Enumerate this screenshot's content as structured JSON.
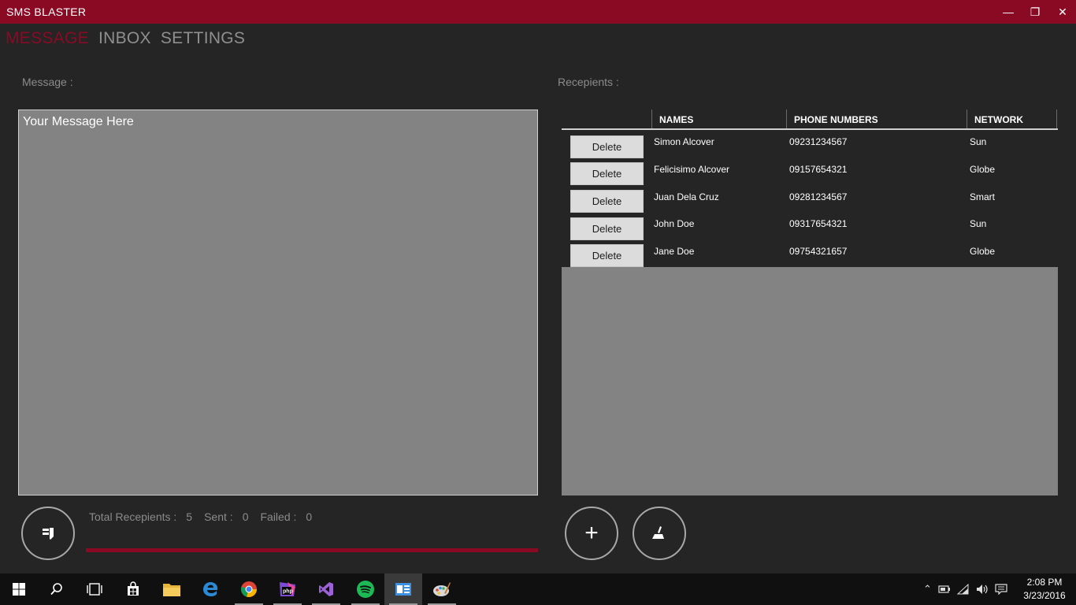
{
  "window": {
    "title": "SMS BLASTER",
    "minimize_glyph": "—",
    "maximize_glyph": "❐",
    "close_glyph": "✕",
    "accent_color": "#8a0a24"
  },
  "nav": {
    "tabs": [
      {
        "label": "MESSAGE",
        "active": true
      },
      {
        "label": "INBOX",
        "active": false
      },
      {
        "label": "SETTINGS",
        "active": false
      }
    ]
  },
  "message": {
    "label": "Message :",
    "placeholder": "Your Message Here"
  },
  "recipients": {
    "label": "Recepients :",
    "columns": [
      "NAMES",
      "PHONE NUMBERS",
      "NETWORK"
    ],
    "delete_label": "Delete",
    "rows": [
      {
        "name": "Simon Alcover",
        "phone": "09231234567",
        "network": "Sun"
      },
      {
        "name": "Felicisimo Alcover",
        "phone": "09157654321",
        "network": "Globe"
      },
      {
        "name": "Juan Dela Cruz",
        "phone": "09281234567",
        "network": "Smart"
      },
      {
        "name": "John Doe",
        "phone": "09317654321",
        "network": "Sun"
      },
      {
        "name": "Jane Doe",
        "phone": "09754321657",
        "network": "Globe"
      }
    ]
  },
  "stats": {
    "total_label": "Total Recepients :",
    "total_value": "5",
    "sent_label": "Sent :",
    "sent_value": "0",
    "failed_label": "Failed :",
    "failed_value": "0"
  },
  "actions": {
    "send_icon": "send-icon",
    "add_icon": "plus-icon",
    "add_glyph": "+",
    "clear_icon": "broom-icon"
  },
  "taskbar": {
    "apps": [
      "start-icon",
      "search-icon",
      "task-view-icon",
      "store-icon",
      "file-explorer-icon",
      "edge-icon",
      "chrome-icon",
      "phpstorm-icon",
      "visual-studio-icon",
      "spotify-icon",
      "sms-blaster-icon",
      "paint-icon"
    ],
    "clock_time": "2:08 PM",
    "clock_date": "3/23/2016"
  }
}
